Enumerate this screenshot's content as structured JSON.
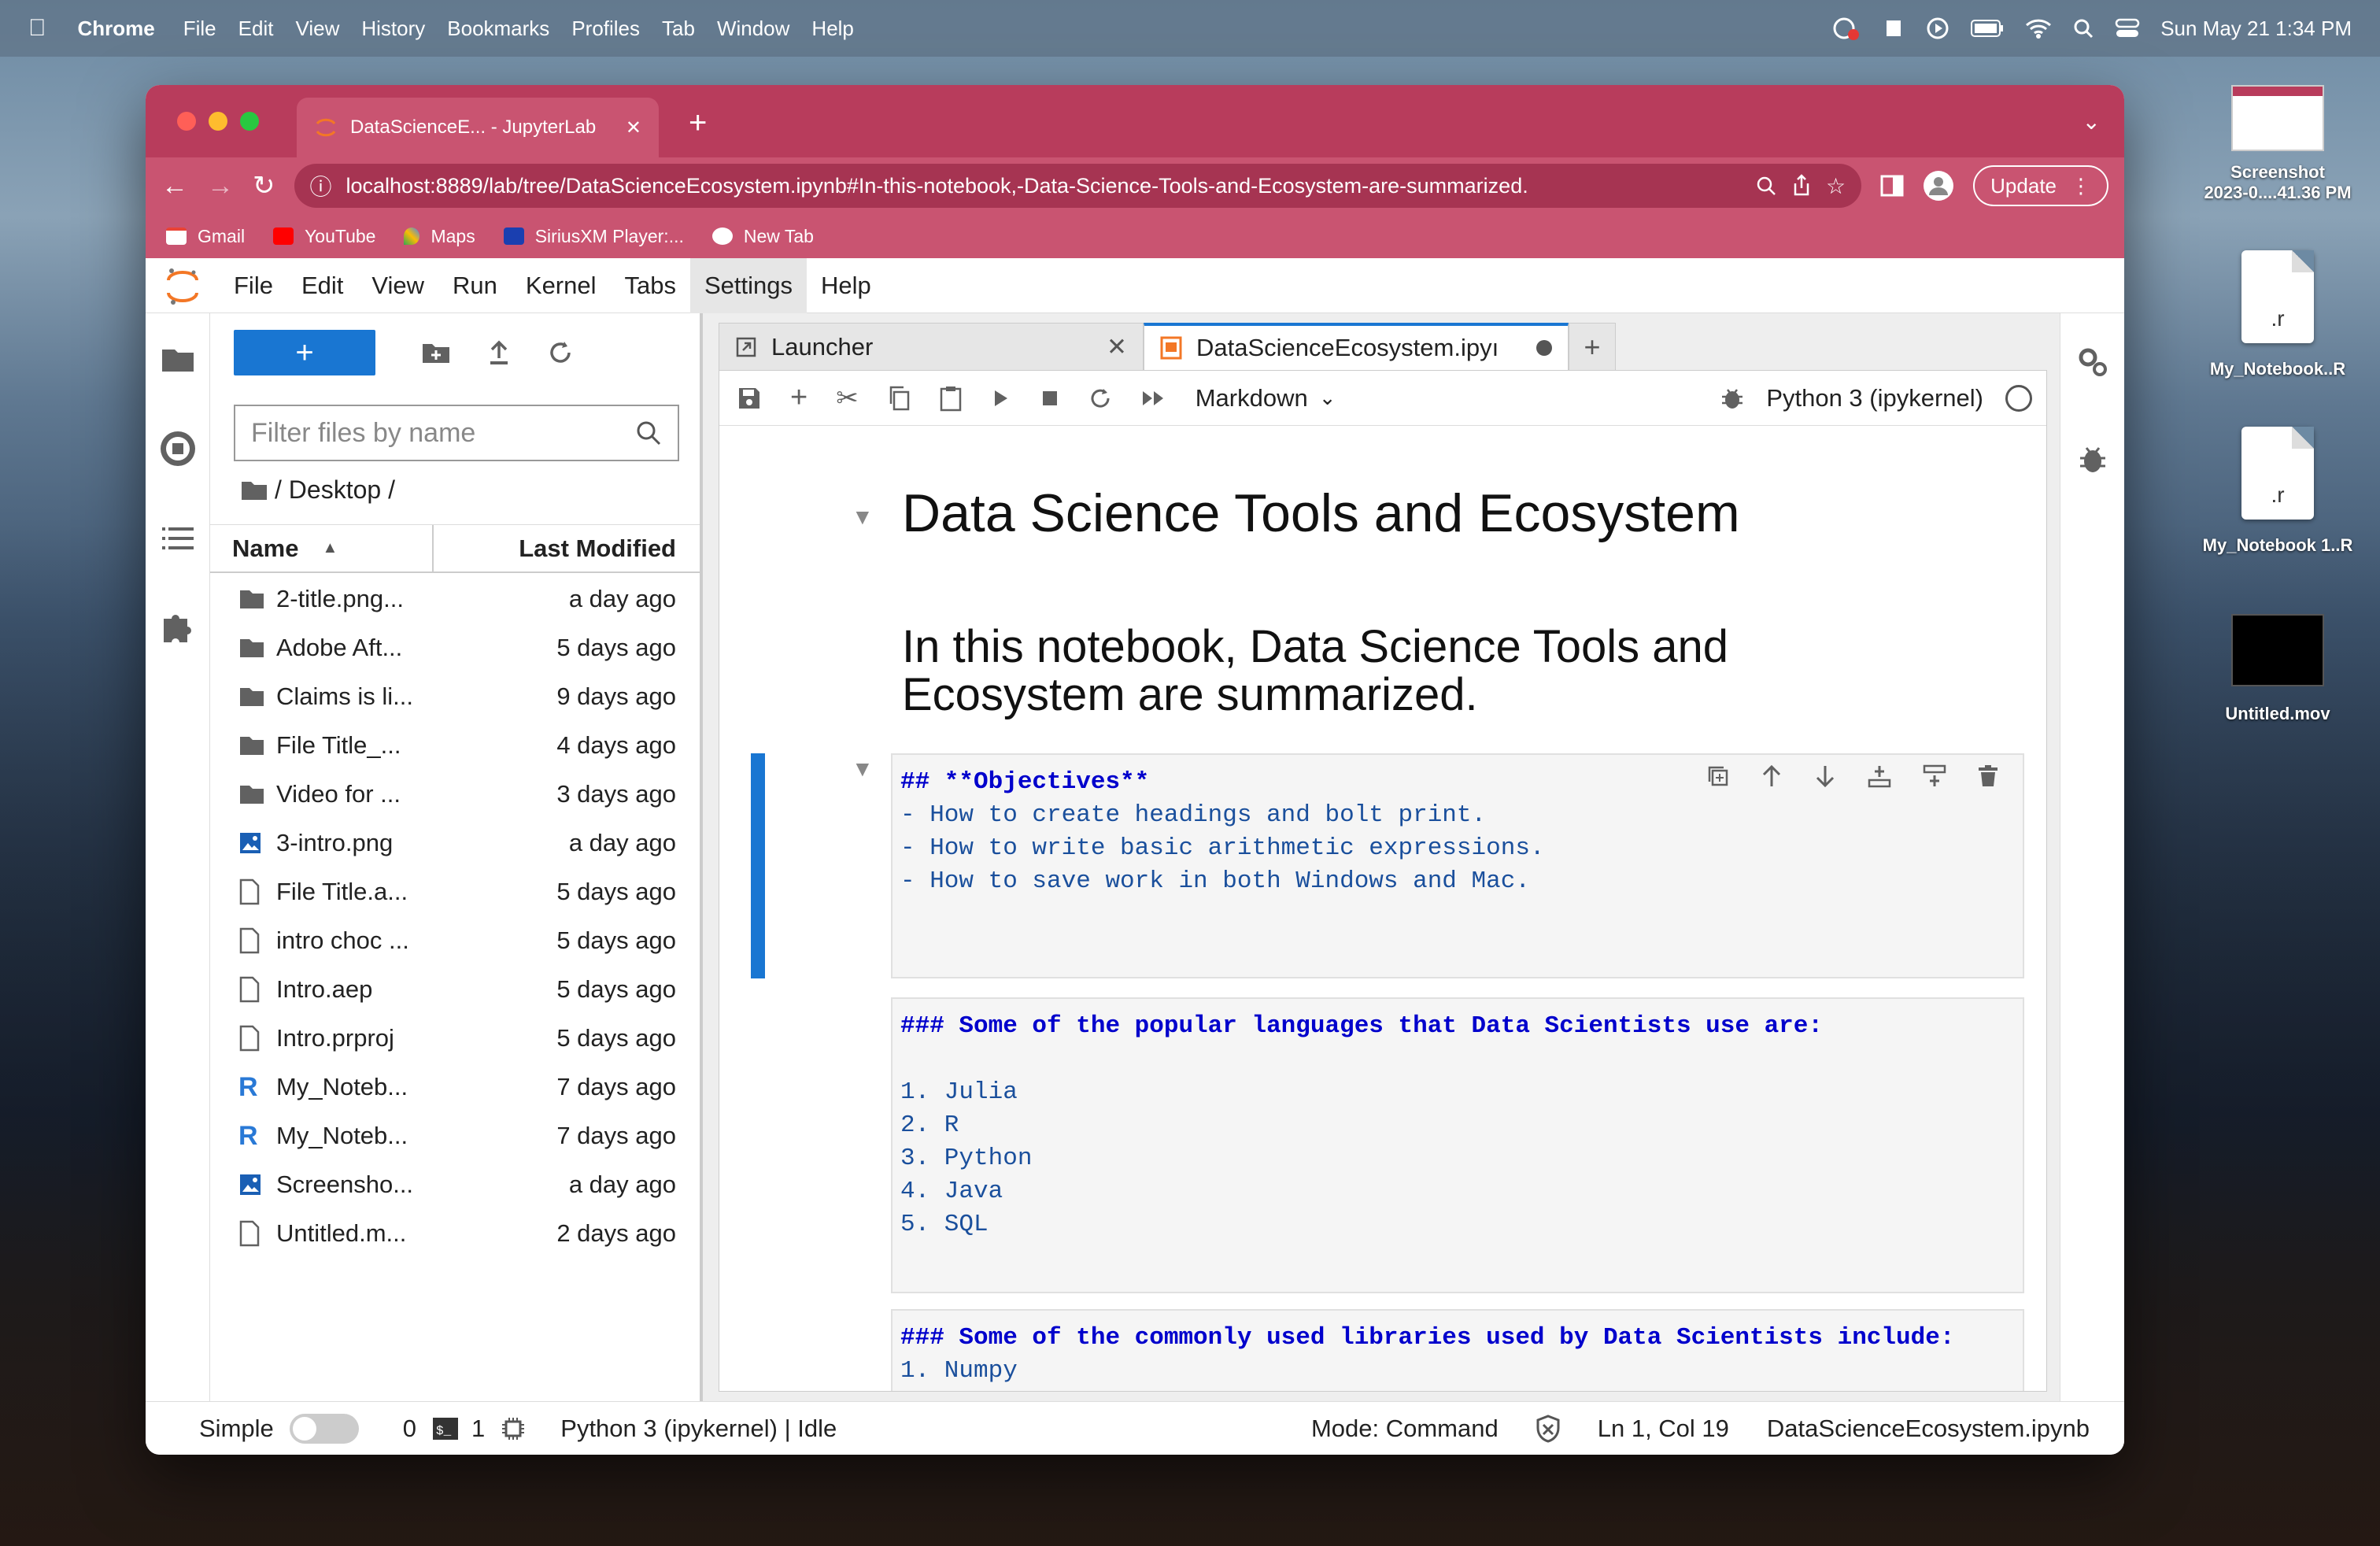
{
  "menubar": {
    "app": "Chrome",
    "items": [
      "File",
      "Edit",
      "View",
      "History",
      "Bookmarks",
      "Profiles",
      "Tab",
      "Window",
      "Help"
    ],
    "clock": "Sun May 21  1:34 PM"
  },
  "desktop": {
    "items": [
      {
        "label": "Screenshot\n2023-0....41.36 PM"
      },
      {
        "label": "My_Notebook..R",
        "glyph": ".r"
      },
      {
        "label": "My_Notebook 1..R",
        "glyph": ".r"
      },
      {
        "label": "Untitled.mov"
      }
    ]
  },
  "browser": {
    "tab_title": "DataScienceE... - JupyterLab",
    "url": "localhost:8889/lab/tree/DataScienceEcosystem.ipynb#In-this-notebook,-Data-Science-Tools-and-Ecosystem-are-summarized.",
    "update_label": "Update",
    "bookmarks": [
      "Gmail",
      "YouTube",
      "Maps",
      "SiriusXM Player:...",
      "New Tab"
    ]
  },
  "jupyter": {
    "menu": [
      "File",
      "Edit",
      "View",
      "Run",
      "Kernel",
      "Tabs",
      "Settings",
      "Help"
    ],
    "filter_placeholder": "Filter files by name",
    "breadcrumb": "/ Desktop /",
    "col_name": "Name",
    "col_modified": "Last Modified",
    "files": [
      {
        "icon": "folder",
        "name": "2-title.png...",
        "modified": "a day ago"
      },
      {
        "icon": "folder",
        "name": "Adobe Aft...",
        "modified": "5 days ago"
      },
      {
        "icon": "folder",
        "name": "Claims is li...",
        "modified": "9 days ago"
      },
      {
        "icon": "folder",
        "name": "File Title_...",
        "modified": "4 days ago"
      },
      {
        "icon": "folder",
        "name": "Video for ...",
        "modified": "3 days ago"
      },
      {
        "icon": "image",
        "name": "3-intro.png",
        "modified": "a day ago"
      },
      {
        "icon": "file",
        "name": "File Title.a...",
        "modified": "5 days ago"
      },
      {
        "icon": "file",
        "name": "intro choc ...",
        "modified": "5 days ago"
      },
      {
        "icon": "file",
        "name": "Intro.aep",
        "modified": "5 days ago"
      },
      {
        "icon": "file",
        "name": "Intro.prproj",
        "modified": "5 days ago"
      },
      {
        "icon": "r",
        "name": "My_Noteb...",
        "modified": "7 days ago"
      },
      {
        "icon": "r",
        "name": "My_Noteb...",
        "modified": "7 days ago"
      },
      {
        "icon": "image",
        "name": "Screensho...",
        "modified": "a day ago"
      },
      {
        "icon": "file",
        "name": "Untitled.m...",
        "modified": "2 days ago"
      }
    ],
    "tabs": {
      "launcher": "Launcher",
      "notebook": "DataScienceEcosystem.ipyı"
    },
    "toolbar": {
      "cell_type": "Markdown",
      "kernel": "Python 3 (ipykernel)"
    },
    "notebook": {
      "h1": "Data Science Tools and Ecosystem",
      "h2": "In this notebook, Data Science Tools and Ecosystem are summarized.",
      "cell1_head": "## **Objectives**",
      "cell1_body": "- How to create headings and bolt print.\n- How to write basic arithmetic expressions.\n- How to save work in both Windows and Mac.",
      "cell2_head": "### Some of the popular languages that Data Scientists use are:",
      "cell2_body": "\n1. Julia\n2. R\n3. Python\n4. Java\n5. SQL",
      "cell3_head": "### Some of the commonly used libraries used by Data Scientists include:",
      "cell3_body": "1. Numpy"
    },
    "status": {
      "simple": "Simple",
      "terminals": "0",
      "kernels": "1",
      "kernel_status": "Python 3 (ipykernel) | Idle",
      "mode": "Mode: Command",
      "position": "Ln 1, Col 19",
      "filename": "DataScienceEcosystem.ipynb"
    }
  },
  "colors": {
    "chrome": "#b83c5c",
    "accent": "#1976d2"
  }
}
